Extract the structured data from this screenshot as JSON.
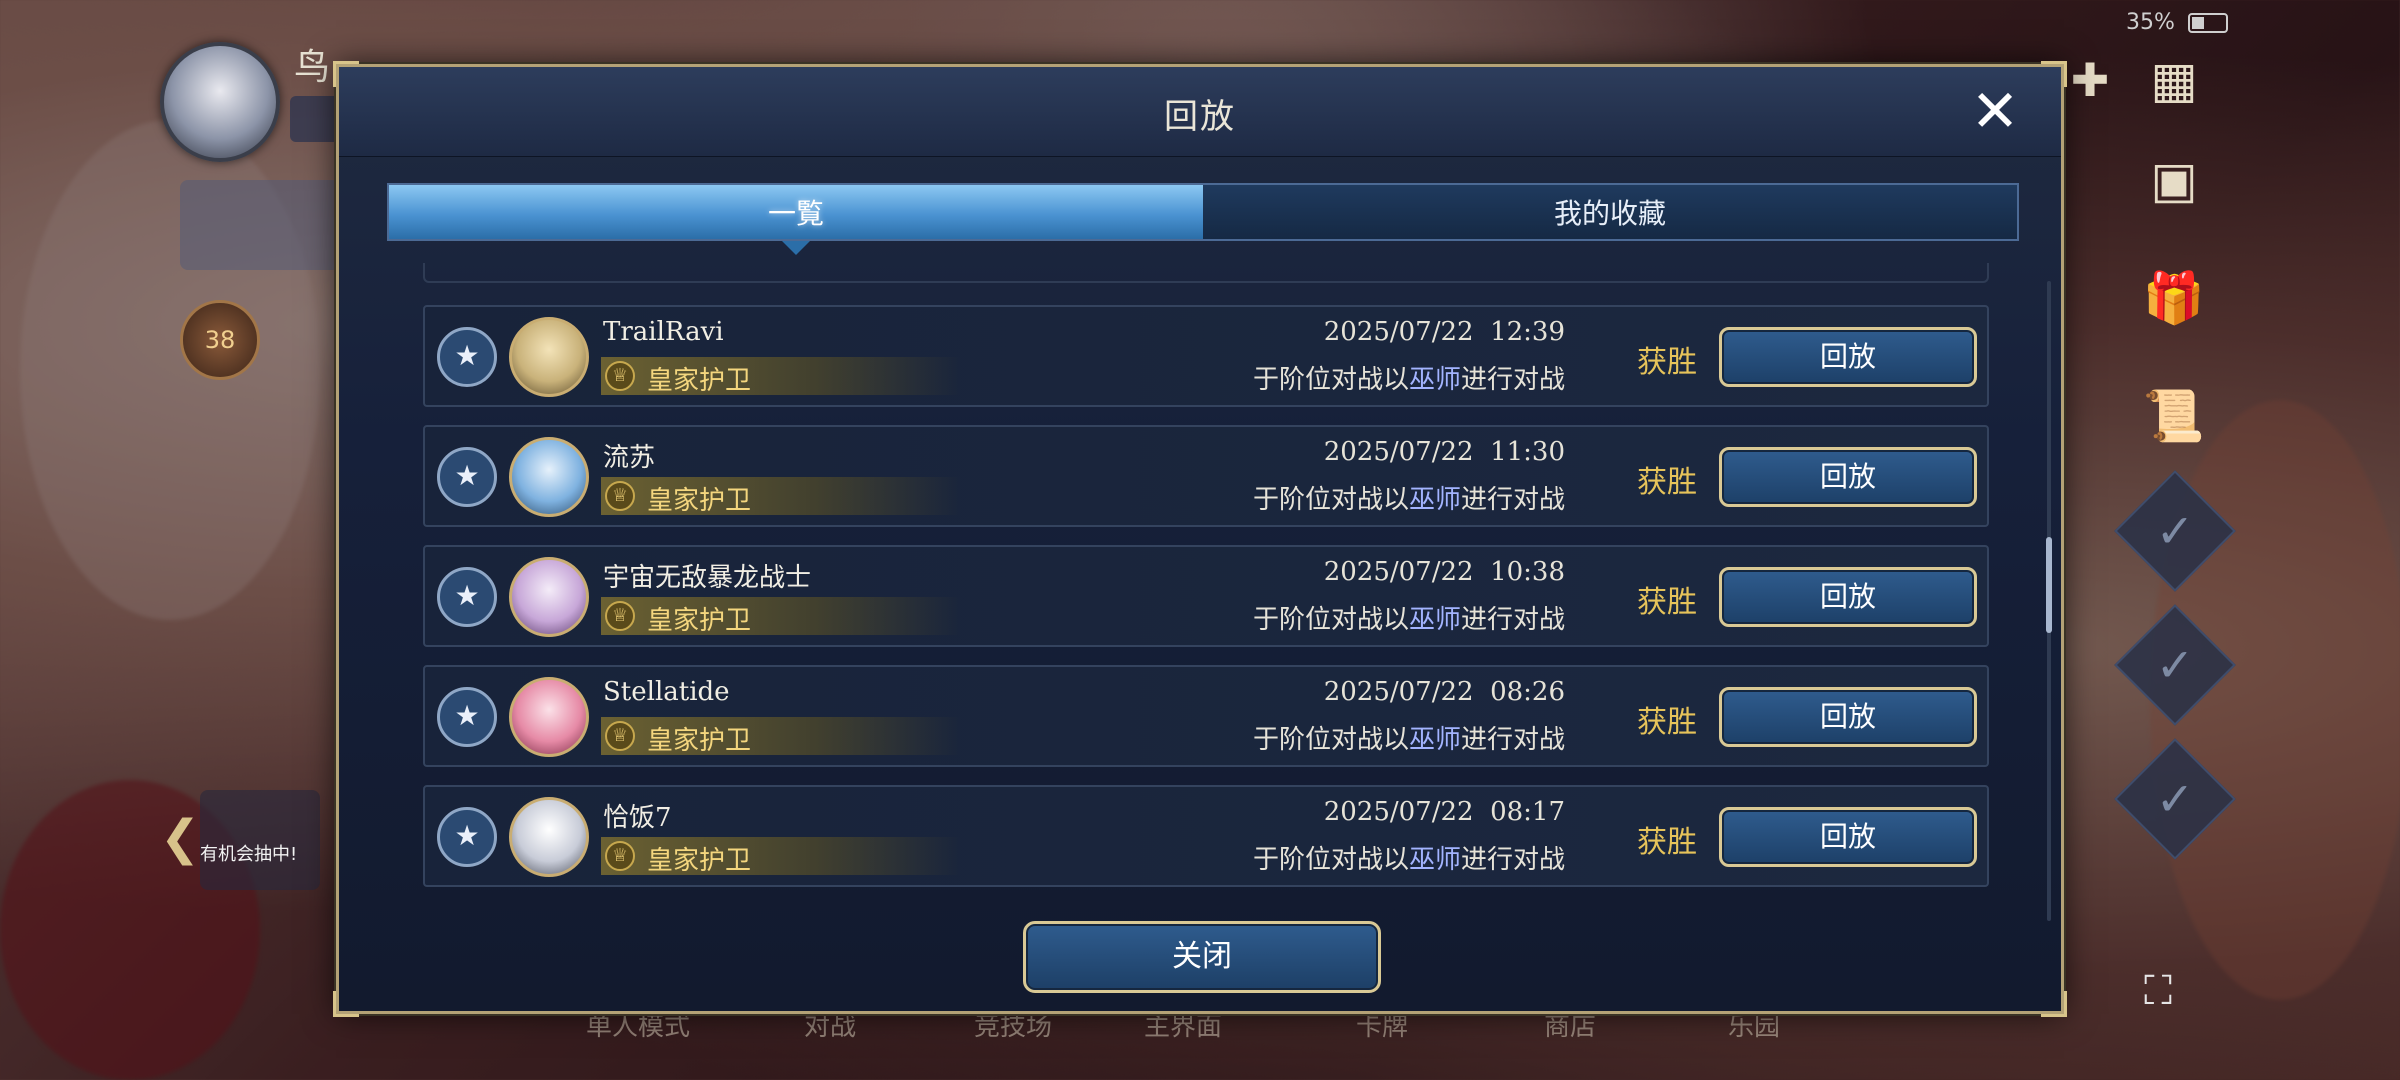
{
  "dialog": {
    "title": "回放",
    "close_icon": "close-icon",
    "footer_close_label": "关闭"
  },
  "tabs": [
    {
      "label": "一覧",
      "active": true
    },
    {
      "label": "我的收藏",
      "active": false
    }
  ],
  "status": {
    "battery_text": "35%"
  },
  "background": {
    "player_name": "鸟",
    "emblem_level": "38",
    "promo_text": "有机会抽中!",
    "bottom_nav": [
      "单人模式",
      "对战",
      "竞技场",
      "主界面",
      "卡牌",
      "商店",
      "乐园"
    ]
  },
  "replays": [
    {
      "name": "TrailRavi",
      "rank": "皇家护卫",
      "date": "2025/07/22  12:39",
      "desc_prefix": "于阶位对战以",
      "class": "巫师",
      "desc_suffix": "进行对战",
      "result": "获胜",
      "button": "回放",
      "avatar_color": "#c9b27a"
    },
    {
      "name": "流苏",
      "rank": "皇家护卫",
      "date": "2025/07/22  11:30",
      "desc_prefix": "于阶位对战以",
      "class": "巫师",
      "desc_suffix": "进行对战",
      "result": "获胜",
      "button": "回放",
      "avatar_color": "#7fb2e0"
    },
    {
      "name": "宇宙无敌暴龙战士",
      "rank": "皇家护卫",
      "date": "2025/07/22  10:38",
      "desc_prefix": "于阶位对战以",
      "class": "巫师",
      "desc_suffix": "进行对战",
      "result": "获胜",
      "button": "回放",
      "avatar_color": "#c7a7d8"
    },
    {
      "name": "Stellatide",
      "rank": "皇家护卫",
      "date": "2025/07/22  08:26",
      "desc_prefix": "于阶位对战以",
      "class": "巫师",
      "desc_suffix": "进行对战",
      "result": "获胜",
      "button": "回放",
      "avatar_color": "#e68aa6"
    },
    {
      "name": "恰饭7",
      "rank": "皇家护卫",
      "date": "2025/07/22  08:17",
      "desc_prefix": "于阶位对战以",
      "class": "巫师",
      "desc_suffix": "进行对战",
      "result": "获胜",
      "button": "回放",
      "avatar_color": "#c8ccd8"
    }
  ],
  "colors": {
    "accent_gold": "#d9c995",
    "result_gold": "#e6c35a",
    "class_blue": "#a3b4ff",
    "tab_active": "#4b93d2"
  }
}
